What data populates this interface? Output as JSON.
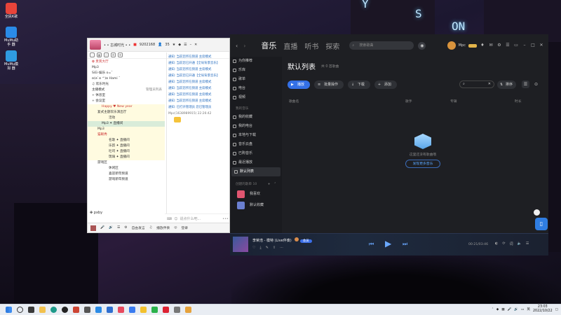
{
  "desktop": {
    "icons": [
      {
        "label": "全民K歌",
        "color": "#e8443a"
      },
      {
        "label": "MuMu助手 器",
        "color": "#2a8be8"
      },
      {
        "label": "MuMu模拟 器",
        "color": "#2f9be0"
      }
    ]
  },
  "chat": {
    "room_title": "• • 古城时光 • •",
    "room_id": "9202168",
    "online_count": "35",
    "tree": [
      {
        "text": "✿ 贵宾大厅",
        "style": ""
      },
      {
        "text": "Mp3",
        "style": ""
      },
      {
        "text": "SiEi-娱乐 o=ˇ",
        "style": ""
      },
      {
        "text": "ʚ(ɵ`ɞ ^)ʚ Hami ˇ",
        "style": ""
      },
      {
        "text": "♫ 欢乐时光",
        "style": ""
      },
      {
        "text": "主播模式",
        "style": ""
      },
      {
        "text": "+ 休息室",
        "style": ""
      },
      {
        "text": "+ 会议室",
        "style": ""
      },
      {
        "text": "Happy ♥ New year",
        "style": "yellow"
      },
      {
        "text": "复式主题欢乐演出厅",
        "style": "yellow"
      },
      {
        "text": "活动",
        "style": "yellow"
      },
      {
        "text": "Mp3 ✦ 直播间",
        "style": "sel"
      },
      {
        "text": "Mp3",
        "style": "yellow"
      },
      {
        "text": "猫眼秀",
        "style": "yellow"
      },
      {
        "text": "名歌 ✦ 直播间",
        "style": "yellow"
      },
      {
        "text": "乐韵 ✦ 直播间",
        "style": "yellow"
      },
      {
        "text": "吐司 ✦ 直播间",
        "style": "yellow"
      },
      {
        "text": "琉璃 ✦ 直播间",
        "style": "yellow"
      },
      {
        "text": "游戏区",
        "style": ""
      },
      {
        "text": "休闲区",
        "style": ""
      },
      {
        "text": "喜迎新年频道",
        "style": ""
      },
      {
        "text": "游戏新年频道",
        "style": ""
      }
    ],
    "manage_label": "管理员列表",
    "messages": [
      "通知: 当前您所在频道 主席模式",
      "通知: 当前您已开通【全局背景音乐】",
      "通知: 当前您所在频道 主席模式",
      "通知: 当前您已开通【全局背景音乐】",
      "通知: 当前您所在频道 主席模式",
      "通知: 当前您所在频道 主席模式",
      "通知: 当前您所在频道 主席模式",
      "通知: 当前您所在频道 主席模式",
      "通知: 已打开管理员 您已管理员"
    ],
    "user_msg": "Mpc(1638989915) 22:26:42",
    "current_user": "pxby",
    "input_placeholder": "说点什么吧...",
    "footer": {
      "mic": "自由发言",
      "music": "播放伴奏",
      "login": "登录"
    }
  },
  "music": {
    "nav_tabs": [
      "音乐",
      "直播",
      "听书",
      "探索"
    ],
    "active_tab": "音乐",
    "search_placeholder": "搜索歌曲",
    "user_name": "Mpc",
    "sidebar_top": [
      "为你推荐",
      "乐库",
      "歌单",
      "电台",
      "视频"
    ],
    "my_music_header": "我的音乐",
    "sidebar_mine": [
      "我的收藏",
      "我的电台",
      "本地与下载",
      "音乐云盘",
      "已购音乐",
      "最近播放",
      "默认列表"
    ],
    "active_side": "默认列表",
    "created_header": "创建的歌单",
    "created_count": "10",
    "playlists": [
      "我喜欢",
      "默认收藏"
    ],
    "playlist_title": "默认列表",
    "song_count": "共 0 首歌曲",
    "buttons": [
      "播放",
      "批量操作",
      "下载",
      "添加"
    ],
    "sort_label": "排序",
    "columns": [
      "歌曲名",
      "歌手",
      "专辑",
      "时长"
    ],
    "empty_text": "这里还没有歌曲哦",
    "discover_button": "发现更多音乐",
    "now_playing": "李荣浩 - 模特 (Live伴奏)",
    "vip_tag": "会员",
    "time": "00:21/03:46"
  },
  "taskbar": {
    "time": "23:03",
    "date": "2022/10/22"
  }
}
